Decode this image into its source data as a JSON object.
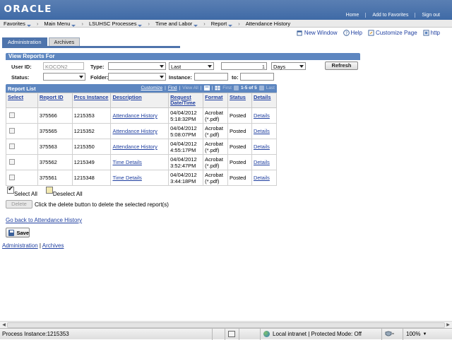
{
  "header": {
    "logo": "ORACLE",
    "links": [
      "Home",
      "Add to Favorites",
      "Sign out"
    ]
  },
  "nav": {
    "items": [
      {
        "label": "Favorites",
        "dropdown": true
      },
      {
        "label": "Main Menu",
        "dropdown": true
      },
      {
        "label": "LSUHSC Processes",
        "dropdown": true
      },
      {
        "label": "Time and Labor",
        "dropdown": true
      },
      {
        "label": "Report",
        "dropdown": true
      },
      {
        "label": "Attendance History",
        "dropdown": false
      }
    ]
  },
  "page_tools": {
    "new_window": "New Window",
    "help": "Help",
    "customize_page": "Customize Page",
    "http": "http"
  },
  "tabs": [
    {
      "label": "Administration",
      "active": true
    },
    {
      "label": "Archives",
      "active": false
    }
  ],
  "view_reports": {
    "title": "View Reports For",
    "user_id_label": "User ID:",
    "user_id_value": "KOCON2",
    "type_label": "Type:",
    "type_value": "",
    "last_value": "Last",
    "count_value": "1",
    "unit_value": "Days",
    "status_label": "Status:",
    "status_value": "",
    "folder_label": "Folder:",
    "folder_value": "",
    "instance_label": "Instance:",
    "instance_value": "",
    "to_label": "to:",
    "to_value": "",
    "refresh": "Refresh"
  },
  "report_list": {
    "title": "Report List",
    "controls": {
      "customize": "Customize",
      "find": "Find",
      "view_all": "View All",
      "first": "First",
      "range": "1-5 of 5",
      "last": "Last"
    },
    "columns": [
      "Select",
      "Report ID",
      "Prcs Instance",
      "Description",
      "Request Date/Time",
      "Format",
      "Status",
      "Details"
    ],
    "rows": [
      {
        "report_id": "375566",
        "prcs_instance": "1215353",
        "description": "Attendance History",
        "date": "04/04/2012",
        "time": "5:18:32PM",
        "format1": "Acrobat",
        "format2": "(*.pdf)",
        "status": "Posted",
        "details": "Details"
      },
      {
        "report_id": "375565",
        "prcs_instance": "1215352",
        "description": "Attendance History",
        "date": "04/04/2012",
        "time": "5:08:07PM",
        "format1": "Acrobat",
        "format2": "(*.pdf)",
        "status": "Posted",
        "details": "Details"
      },
      {
        "report_id": "375563",
        "prcs_instance": "1215350",
        "description": "Attendance History",
        "date": "04/04/2012",
        "time": "4:55:17PM",
        "format1": "Acrobat",
        "format2": "(*.pdf)",
        "status": "Posted",
        "details": "Details"
      },
      {
        "report_id": "375562",
        "prcs_instance": "1215349",
        "description": "Time Details",
        "date": "04/04/2012",
        "time": "3:52:47PM",
        "format1": "Acrobat",
        "format2": "(*.pdf)",
        "status": "Posted",
        "details": "Details"
      },
      {
        "report_id": "375561",
        "prcs_instance": "1215348",
        "description": "Time Details",
        "date": "04/04/2012",
        "time": "3:44:18PM",
        "format1": "Acrobat",
        "format2": "(*.pdf)",
        "status": "Posted",
        "details": "Details"
      }
    ]
  },
  "actions": {
    "select_all": "Select All",
    "deselect_all": "Deselect All",
    "delete": "Delete",
    "delete_hint": "Click the delete button to delete the selected report(s)",
    "back_link": "Go back to Attendance History",
    "save": "Save"
  },
  "bottom_links": {
    "administration": "Administration",
    "separator": "|",
    "archives": "Archives"
  },
  "statusbar": {
    "process_instance": "Process Instance:1215353",
    "zone": "Local intranet | Protected Mode: Off",
    "zoom": "100%"
  },
  "colors": {
    "header_blue": "#4a73ad",
    "box_title_blue": "#5d86c0",
    "link_blue": "#1f3fa0"
  }
}
